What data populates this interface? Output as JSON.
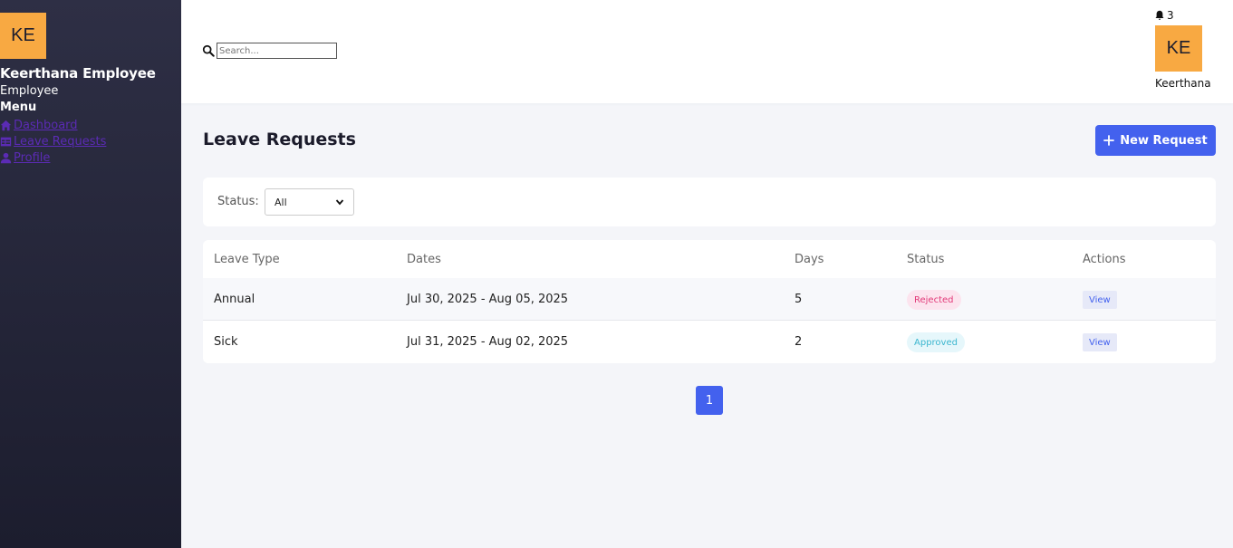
{
  "sidebar": {
    "avatar_initials": "KE",
    "user_name": "Keerthana Employee",
    "user_role": "Employee",
    "menu_title": "Menu",
    "items": [
      {
        "label": "Dashboard",
        "icon": "home-icon"
      },
      {
        "label": "Leave Requests",
        "icon": "table-icon"
      },
      {
        "label": "Profile",
        "icon": "user-icon"
      }
    ]
  },
  "header": {
    "search_placeholder": "Search...",
    "notification_count": "3",
    "avatar_initials": "KE",
    "user_name": "Keerthana"
  },
  "main": {
    "title": "Leave Requests",
    "new_request_label": "New Request",
    "filter": {
      "label": "Status:",
      "selected": "All"
    },
    "table": {
      "headers": [
        "Leave Type",
        "Dates",
        "Days",
        "Status",
        "Actions"
      ],
      "rows": [
        {
          "type": "Annual",
          "dates": "Jul 30, 2025 - Aug 05, 2025",
          "days": "5",
          "status": "Rejected",
          "action": "View"
        },
        {
          "type": "Sick",
          "dates": "Jul 31, 2025 - Aug 02, 2025",
          "days": "2",
          "status": "Approved",
          "action": "View"
        }
      ]
    },
    "pagination": {
      "current_page": "1"
    }
  },
  "colors": {
    "accent": "#4361ee",
    "avatar": "#f8a942",
    "rejected": "#e23a79",
    "approved": "#3bb6cf",
    "sidebar": "#25263a"
  }
}
